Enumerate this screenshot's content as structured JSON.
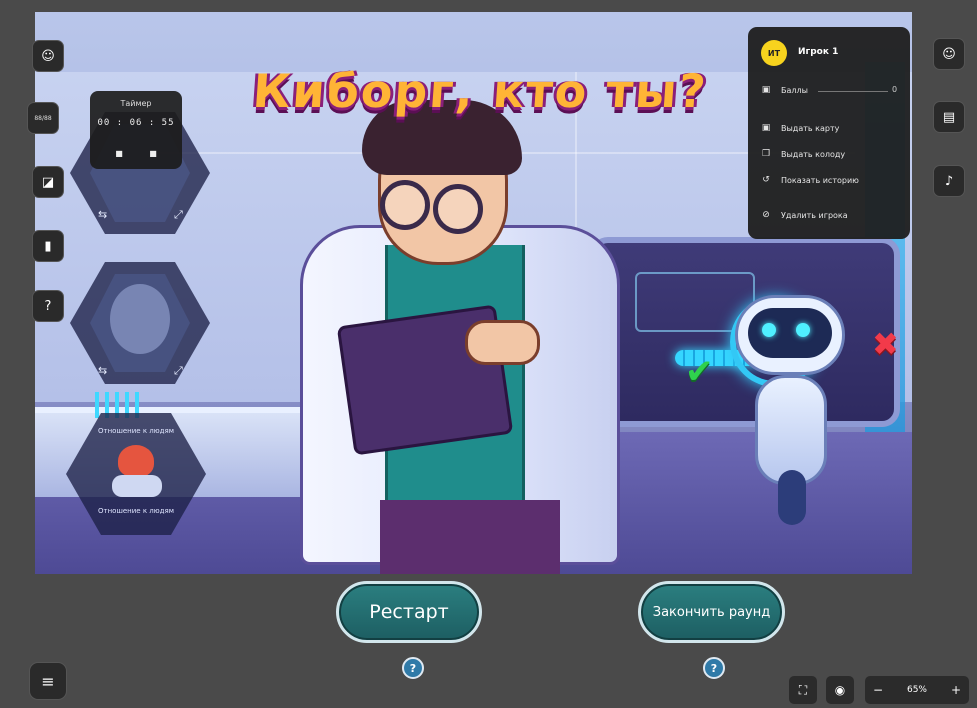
{
  "game": {
    "title": "Киборг, кто ты?"
  },
  "timer": {
    "title": "Таймер",
    "time": "00 : 06 : 55"
  },
  "left_toolbar": {
    "small_label": "88/88"
  },
  "hex_decks": {
    "bottom_top_label": "Отношение к людям",
    "bottom_bottom_label": "Отношение к людям"
  },
  "player_menu": {
    "avatar_initials": "ИТ",
    "player_name": "Игрок 1",
    "score_label": "Баллы",
    "score_value": "0",
    "items": [
      {
        "label": "Выдать карту",
        "icon": "card-icon"
      },
      {
        "label": "Выдать колоду",
        "icon": "deck-icon"
      },
      {
        "label": "Показать историю",
        "icon": "history-icon"
      },
      {
        "label": "Удалить игрока",
        "icon": "ban-icon"
      }
    ]
  },
  "buttons": {
    "restart": "Рестарт",
    "end_round": "Закончить раунд",
    "help": "?"
  },
  "zoom": {
    "minus": "−",
    "value": "65%",
    "plus": "+"
  },
  "colors": {
    "accent_teal": "#1d5e62",
    "avatar_yellow": "#f7d31e",
    "title_orange": "#ffb436"
  }
}
